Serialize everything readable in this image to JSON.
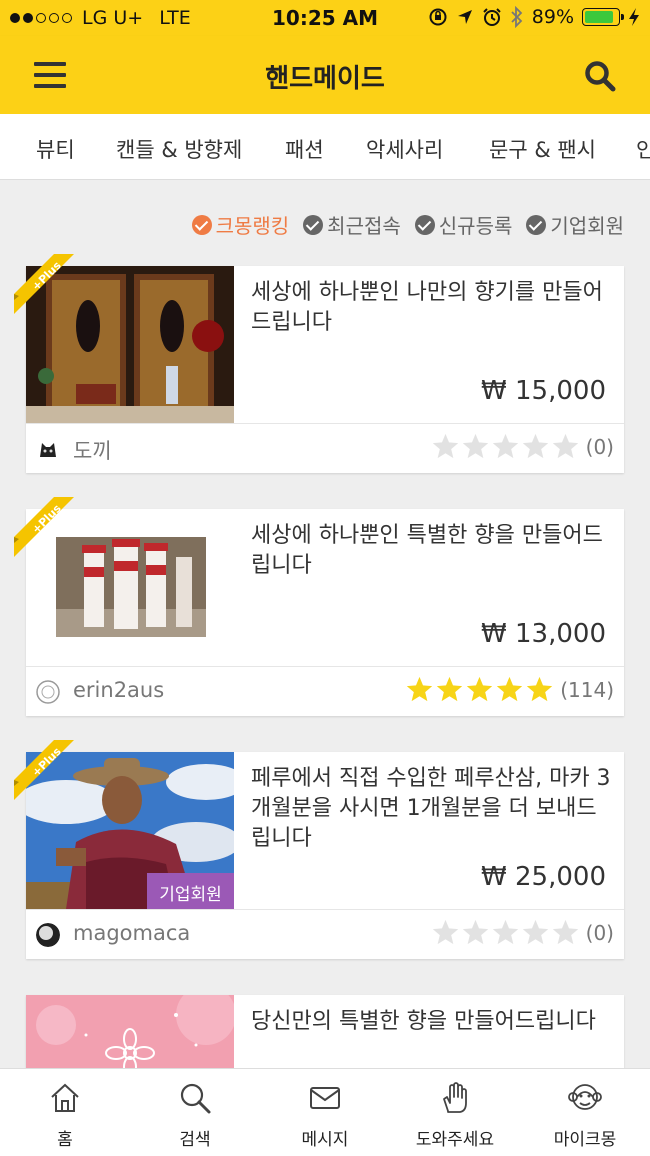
{
  "status_bar": {
    "carrier": "LG U+",
    "network": "LTE",
    "time": "10:25 AM",
    "battery": "89%",
    "battery_level": 0.89
  },
  "nav": {
    "title": "핸드메이드",
    "menu_icon": "hamburger-menu-icon",
    "search_icon": "search-icon"
  },
  "categories": [
    "뷰티",
    "캔들 & 방향제",
    "패션",
    "악세사리",
    "문구 & 팬시",
    "인"
  ],
  "filters": [
    {
      "label": "크몽랭킹",
      "active": true
    },
    {
      "label": "최근접속",
      "active": false
    },
    {
      "label": "신규등록",
      "active": false
    },
    {
      "label": "기업회원",
      "active": false
    }
  ],
  "products": [
    {
      "title": "세상에 하나뿐인 나만의 향기를 만들어드립니다",
      "price": "₩ 15,000",
      "seller": "도끼",
      "rating_count": "(0)",
      "stars": 0,
      "plus": "+Plus",
      "corp_badge": ""
    },
    {
      "title": "세상에 하나뿐인 특별한 향을 만들어드립니다",
      "price": "₩ 13,000",
      "seller": "erin2aus",
      "rating_count": "(114)",
      "stars": 5,
      "plus": "+Plus",
      "corp_badge": ""
    },
    {
      "title": "페루에서 직접 수입한 페루산삼, 마카 3개월분을 사시면 1개월분을 더 보내드립니다",
      "price": "₩ 25,000",
      "seller": "magomaca",
      "rating_count": "(0)",
      "stars": 0,
      "plus": "+Plus",
      "corp_badge": "기업회원"
    },
    {
      "title": "당신만의 특별한 향을 만들어드립니다",
      "price": "",
      "seller": "",
      "rating_count": "",
      "stars": 0,
      "plus": "",
      "corp_badge": ""
    }
  ],
  "tabs": [
    {
      "label": "홈",
      "icon": "home-icon"
    },
    {
      "label": "검색",
      "icon": "search-icon"
    },
    {
      "label": "메시지",
      "icon": "envelope-icon"
    },
    {
      "label": "도와주세요",
      "icon": "hand-icon"
    },
    {
      "label": "마이크몽",
      "icon": "monkey-face-icon"
    }
  ],
  "colors": {
    "brand_yellow": "#fcd116",
    "active_orange": "#ef7b44",
    "star_yellow": "#f7d417",
    "corp_purple": "#9b59b6"
  }
}
